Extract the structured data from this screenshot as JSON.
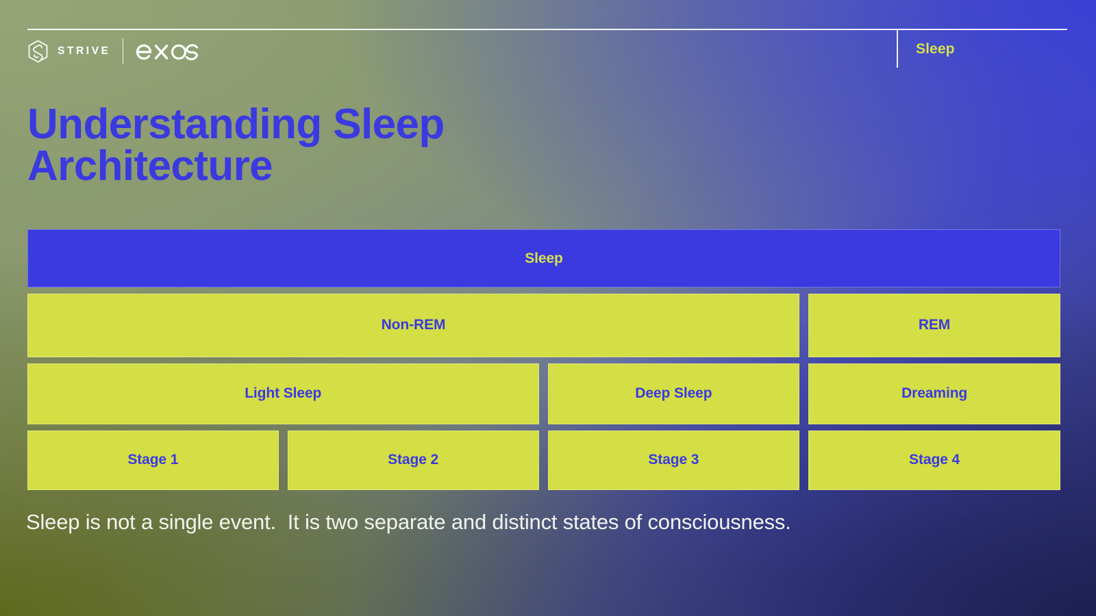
{
  "header": {
    "brand_strive": "STRIVE",
    "brand_exos": "exos",
    "topic_tag": "Sleep",
    "strive_icon": "strive-hexagon-logo-icon",
    "exos_icon": "exos-wordmark-icon"
  },
  "title": "Understanding Sleep\nArchitecture",
  "colors": {
    "accent_blue": "#3a3ae0",
    "accent_yellow": "#d4de45",
    "tag_yellow": "#d5e04d",
    "caption_white": "#f2f3ee"
  },
  "chart_data": {
    "type": "diagram",
    "title": "Understanding Sleep Architecture",
    "levels": [
      {
        "level": 1,
        "name": "root",
        "nodes": [
          {
            "label": "Sleep",
            "style": "blue",
            "span": 4
          }
        ]
      },
      {
        "level": 2,
        "name": "sleep-type",
        "nodes": [
          {
            "label": "Non-REM",
            "style": "yellow",
            "span": 3
          },
          {
            "label": "REM",
            "style": "yellow",
            "span": 1
          }
        ]
      },
      {
        "level": 3,
        "name": "sleep-phase",
        "nodes": [
          {
            "label": "Light Sleep",
            "style": "yellow",
            "span": 2
          },
          {
            "label": "Deep Sleep",
            "style": "yellow",
            "span": 1
          },
          {
            "label": "Dreaming",
            "style": "yellow",
            "span": 1
          }
        ]
      },
      {
        "level": 4,
        "name": "sleep-stage",
        "nodes": [
          {
            "label": "Stage 1",
            "style": "yellow",
            "span": 1
          },
          {
            "label": "Stage 2",
            "style": "yellow",
            "span": 1
          },
          {
            "label": "Stage 3",
            "style": "yellow",
            "span": 1
          },
          {
            "label": "Stage 4",
            "style": "yellow",
            "span": 1
          }
        ]
      }
    ]
  },
  "caption": "Sleep is not a single event.  It is two separate and distinct states of consciousness."
}
